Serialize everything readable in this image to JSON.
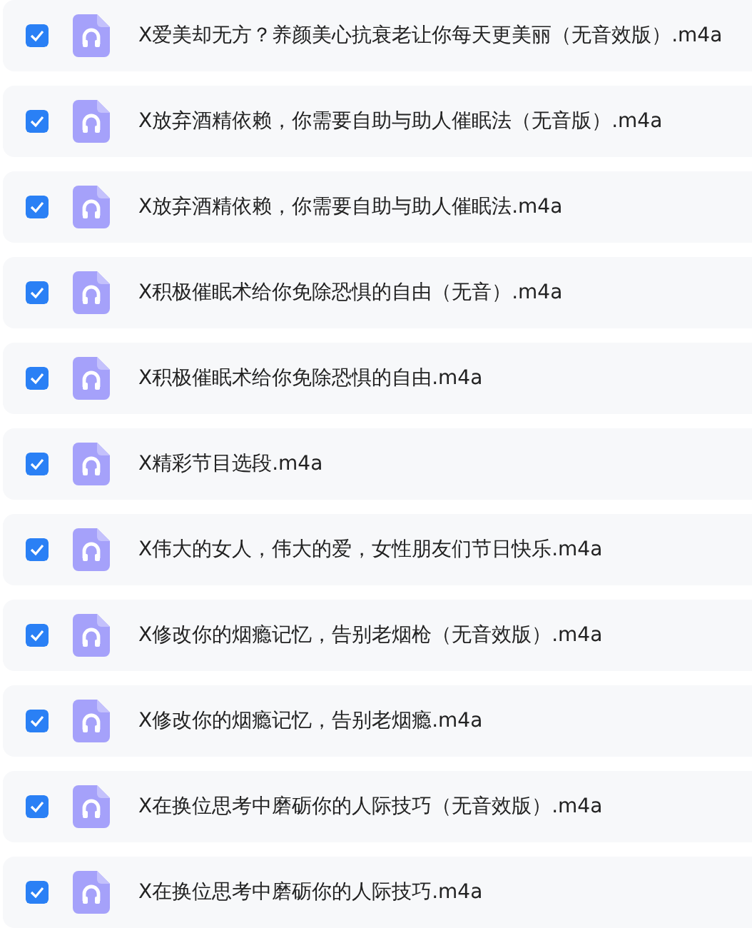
{
  "files": [
    {
      "name": "X爱美却无方？养颜美心抗衰老让你每天更美丽（无音效版）.m4a",
      "checked": true
    },
    {
      "name": "X放弃酒精依赖，你需要自助与助人催眠法（无音版）.m4a",
      "checked": true
    },
    {
      "name": "X放弃酒精依赖，你需要自助与助人催眠法.m4a",
      "checked": true
    },
    {
      "name": "X积极催眠术给你免除恐惧的自由（无音）.m4a",
      "checked": true
    },
    {
      "name": "X积极催眠术给你免除恐惧的自由.m4a",
      "checked": true
    },
    {
      "name": "X精彩节目选段.m4a",
      "checked": true
    },
    {
      "name": "X伟大的女人，伟大的爱，女性朋友们节日快乐.m4a",
      "checked": true
    },
    {
      "name": "X修改你的烟瘾记忆，告别老烟枪（无音效版）.m4a",
      "checked": true
    },
    {
      "name": "X修改你的烟瘾记忆，告别老烟瘾.m4a",
      "checked": true
    },
    {
      "name": "X在换位思考中磨砺你的人际技巧（无音效版）.m4a",
      "checked": true
    },
    {
      "name": "X在换位思考中磨砺你的人际技巧.m4a",
      "checked": true
    }
  ]
}
